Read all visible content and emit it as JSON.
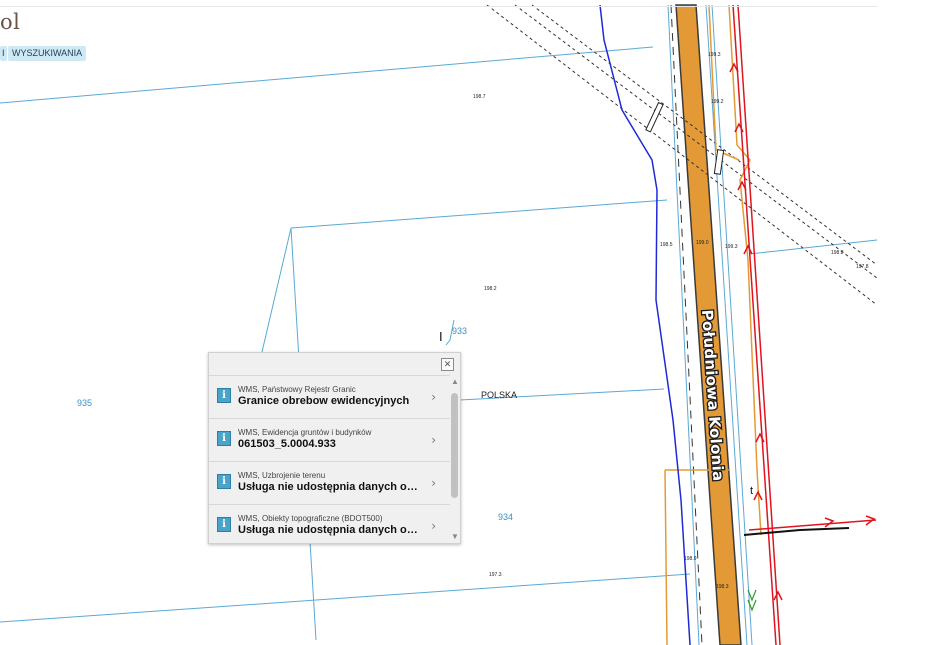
{
  "header": {
    "site_title": "ol",
    "search_prefix": "I",
    "search_label": "WYSZUKIWANIA"
  },
  "map": {
    "street_name": "Południowa Kolonia",
    "country_label": "POLSKA",
    "parcels": [
      "935",
      "934",
      "933"
    ],
    "elevations": [
      "198.7",
      "199.3",
      "199.2",
      "199.0",
      "198.5",
      "199.3",
      "198.2",
      "198.8",
      "198.9",
      "197.8",
      "197.3",
      "198.3"
    ],
    "cursor_mark": "I",
    "pin_mark": "t",
    "colors": {
      "parcel_lines": "#5aa9d6",
      "road_fill": "#e39a36",
      "road_edge": "#d7881f",
      "utility_red": "#e0141e",
      "utility_blue": "#1e2ad6",
      "utility_green": "#2e9a2e",
      "road_outline": "#3a3a3a"
    }
  },
  "popup": {
    "close_label": "✕",
    "items": [
      {
        "source": "WMS, Państwowy Rejestr Granic",
        "title": "Granice obrebow ewidencyjnych"
      },
      {
        "source": "WMS, Ewidencja gruntów i budynków",
        "title": "061503_5.0004.933"
      },
      {
        "source": "WMS, Uzbrojenie terenu",
        "title": "Usługa nie udostępnia danych opi..."
      },
      {
        "source": "WMS, Obiekty topograficzne (BDOT500)",
        "title": "Usługa nie udostępnia danych opi..."
      }
    ],
    "chevron_symbol": "›",
    "scroll_up": "▲",
    "scroll_down": "▼"
  }
}
